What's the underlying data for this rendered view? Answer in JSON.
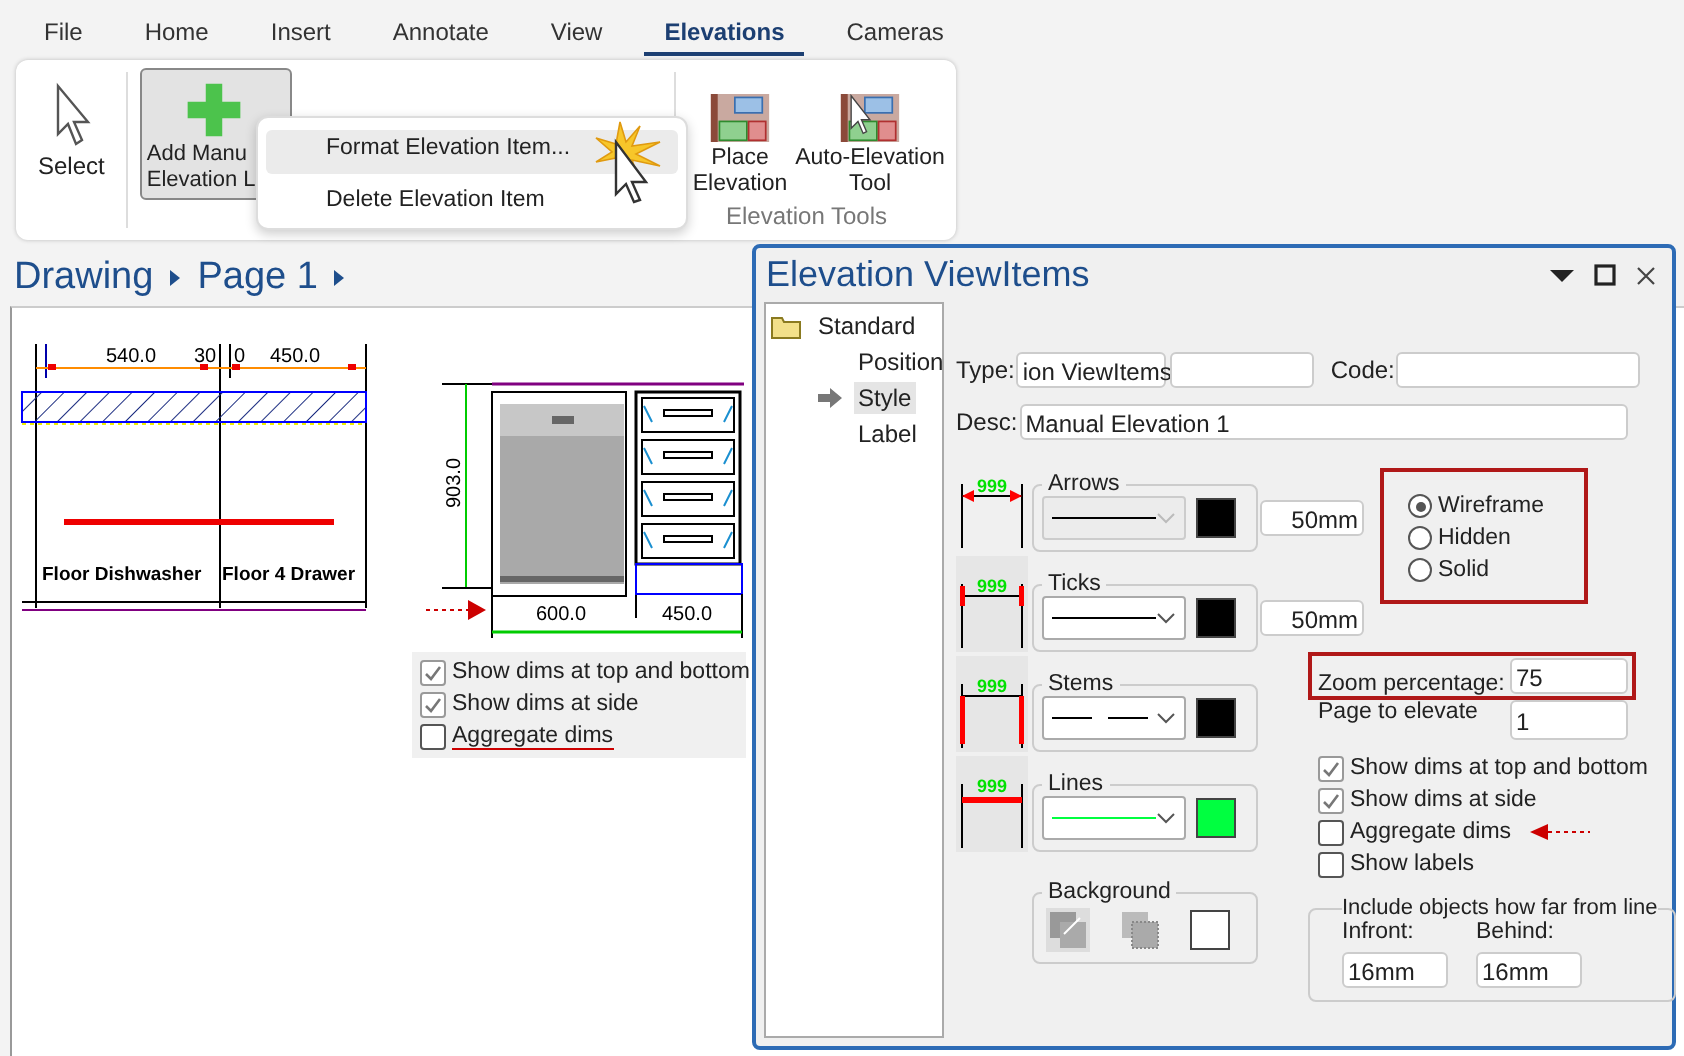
{
  "menu_tabs": [
    {
      "label": "File",
      "selected": false
    },
    {
      "label": "Home",
      "selected": false
    },
    {
      "label": "Insert",
      "selected": false
    },
    {
      "label": "Annotate",
      "selected": false
    },
    {
      "label": "View",
      "selected": false
    },
    {
      "label": "Elevations",
      "selected": true
    },
    {
      "label": "Cameras",
      "selected": false
    }
  ],
  "ribbon": {
    "buttons": [
      {
        "kind": "pointer",
        "lines": [
          "Select"
        ],
        "pressed": false
      },
      {
        "kind": "add",
        "lines": [
          "Add Manu",
          "Elevation L"
        ],
        "pressed": true
      },
      {
        "kind": "place",
        "lines": [
          "Place",
          "Elevation"
        ],
        "pressed": false
      },
      {
        "kind": "auto",
        "lines": [
          "Auto-Elevation",
          "Tool"
        ],
        "pressed": false
      }
    ],
    "group_label": "Elevation Tools"
  },
  "context_menu": [
    {
      "label": "Format Elevation Item...",
      "selected": true
    },
    {
      "label": "Delete Elevation Item",
      "selected": false
    }
  ],
  "breadcrumb": [
    "Drawing",
    "Page 1"
  ],
  "drawing": {
    "top_dims": [
      "540.0",
      "30",
      "0",
      "450.0"
    ],
    "cabinet_labels": [
      "Floor Dishwasher",
      "Floor 4 Drawer"
    ],
    "side_dim": "903.0",
    "bottom_dims": [
      "600.0",
      "450.0"
    ]
  },
  "canvas_options": [
    {
      "label": "Show dims at top and bottom",
      "checked": true
    },
    {
      "label": "Show dims at side",
      "checked": true
    },
    {
      "label": "Aggregate dims",
      "checked": false
    }
  ],
  "dialog": {
    "title": "Elevation ViewItems",
    "tree": [
      {
        "label": "Standard",
        "children": [
          {
            "label": "Position",
            "selected": false
          },
          {
            "label": "Style",
            "selected": true
          },
          {
            "label": "Label",
            "selected": false
          }
        ]
      }
    ],
    "type_label": "Type:",
    "type_value": "ion ViewItems",
    "code_label": "Code:",
    "desc_label": "Desc:",
    "desc_value": "Manual Elevation 1",
    "line_groups": [
      {
        "title": "Arrows",
        "kind": "arrow",
        "preview_label": "999",
        "dashed": false,
        "color": "#000000",
        "size": "50mm",
        "disabled": true
      },
      {
        "title": "Ticks",
        "kind": "tick",
        "preview_label": "999",
        "dashed": false,
        "color": "#000000",
        "size": "50mm",
        "disabled": false
      },
      {
        "title": "Stems",
        "kind": "stem",
        "preview_label": "999",
        "dashed": true,
        "color": "#000000",
        "disabled": false
      },
      {
        "title": "Lines",
        "kind": "line",
        "preview_label": "999",
        "dashed": false,
        "color": "#00ff40",
        "disabled": false
      }
    ],
    "render_modes": [
      {
        "label": "Wireframe",
        "selected": true
      },
      {
        "label": "Hidden",
        "selected": false
      },
      {
        "label": "Solid",
        "selected": false
      }
    ],
    "zoom": {
      "label": "Zoom percentage:",
      "value": "75"
    },
    "page": {
      "label": "Page to elevate",
      "value": "1"
    },
    "options": [
      {
        "label": "Show dims at top and bottom",
        "checked": true
      },
      {
        "label": "Show dims at side",
        "checked": true
      },
      {
        "label": "Aggregate dims",
        "checked": false
      },
      {
        "label": "Show labels",
        "checked": false
      }
    ],
    "background": {
      "title": "Background",
      "color": "#ffffff"
    },
    "include": {
      "title": "Include objects how far from line",
      "infront_label": "Infront:",
      "infront_value": "16mm",
      "behind_label": "Behind:",
      "behind_value": "16mm"
    }
  }
}
